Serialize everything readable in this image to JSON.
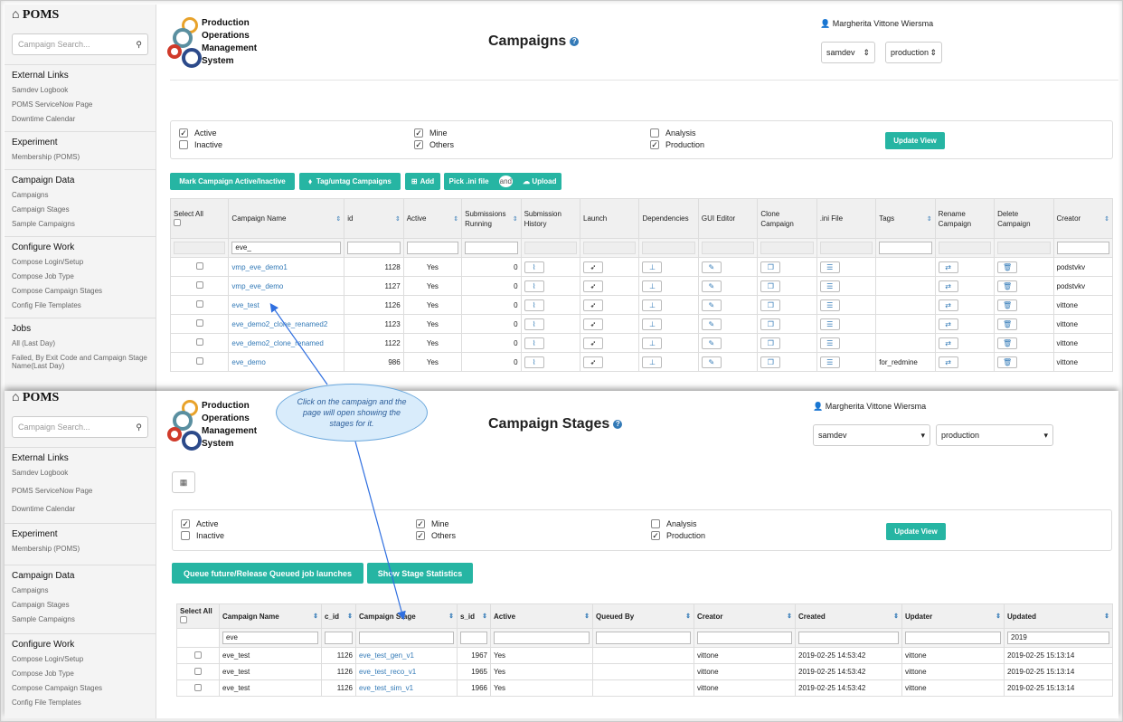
{
  "sidebar": {
    "brand": "POMS",
    "search_placeholder": "Campaign Search...",
    "sections": [
      {
        "title": "External Links",
        "items": [
          "Samdev Logbook",
          "POMS ServiceNow Page",
          "Downtime Calendar"
        ]
      },
      {
        "title": "Experiment",
        "items": [
          "Membership (POMS)"
        ]
      },
      {
        "title": "Campaign Data",
        "items": [
          "Campaigns",
          "Campaign Stages",
          "Sample Campaigns"
        ]
      },
      {
        "title": "Configure Work",
        "items": [
          "Compose Login/Setup",
          "Compose Job Type",
          "Compose Campaign Stages",
          "Config File Templates"
        ]
      },
      {
        "title": "Jobs",
        "items": [
          "All (Last Day)",
          "Failed, By Exit Code and Campaign Stage",
          "Name(Last Day)"
        ]
      }
    ]
  },
  "logo": {
    "lines": [
      "Production",
      "Operations",
      "Management",
      "System"
    ]
  },
  "user_name": "Margherita Vittone Wiersma",
  "experiment_select": "samdev",
  "role_select": "production",
  "filters": {
    "active": "Active",
    "inactive": "Inactive",
    "mine": "Mine",
    "others": "Others",
    "analysis": "Analysis",
    "production": "Production",
    "update": "Update View"
  },
  "campaigns_page": {
    "title": "Campaigns",
    "buttons": {
      "mark": "Mark Campaign Active/Inactive",
      "tag": "Tag/untag Campaigns",
      "add": "Add",
      "pick": "Pick .ini file",
      "and": "and",
      "upload": "Upload"
    },
    "columns": [
      "Select All",
      "Campaign Name",
      "id",
      "Active",
      "Submissions Running",
      "Submission History",
      "Launch",
      "Dependencies",
      "GUI Editor",
      "Clone Campaign",
      ".ini File",
      "Tags",
      "Rename Campaign",
      "Delete Campaign",
      "Creator"
    ],
    "filter_name": "eve_",
    "rows": [
      {
        "name": "vmp_eve_demo1",
        "id": "1128",
        "active": "Yes",
        "running": "0",
        "tags": "",
        "creator": "podstvkv"
      },
      {
        "name": "vmp_eve_demo",
        "id": "1127",
        "active": "Yes",
        "running": "0",
        "tags": "",
        "creator": "podstvkv"
      },
      {
        "name": "eve_test",
        "id": "1126",
        "active": "Yes",
        "running": "0",
        "tags": "",
        "creator": "vittone"
      },
      {
        "name": "eve_demo2_clone_renamed2",
        "id": "1123",
        "active": "Yes",
        "running": "0",
        "tags": "",
        "creator": "vittone"
      },
      {
        "name": "eve_demo2_clone_renamed",
        "id": "1122",
        "active": "Yes",
        "running": "0",
        "tags": "",
        "creator": "vittone"
      },
      {
        "name": "eve_demo",
        "id": "986",
        "active": "Yes",
        "running": "0",
        "tags": "for_redmine",
        "creator": "vittone"
      }
    ]
  },
  "stages_page": {
    "title": "Campaign Stages",
    "buttons": {
      "queue": "Queue future/Release Queued job launches",
      "stats": "Show Stage Statistics"
    },
    "columns": [
      "Select All",
      "Campaign Name",
      "c_id",
      "Campaign Stage",
      "s_id",
      "Active",
      "Queued By",
      "Creator",
      "Created",
      "Updater",
      "Updated"
    ],
    "filter_name": "eve",
    "filter_updated": "2019",
    "rows": [
      {
        "campaign": "eve_test",
        "c_id": "1126",
        "stage": "eve_test_gen_v1",
        "s_id": "1967",
        "active": "Yes",
        "queued": "",
        "creator": "vittone",
        "created": "2019-02-25 14:53:42",
        "updater": "vittone",
        "updated": "2019-02-25 15:13:14"
      },
      {
        "campaign": "eve_test",
        "c_id": "1126",
        "stage": "eve_test_reco_v1",
        "s_id": "1965",
        "active": "Yes",
        "queued": "",
        "creator": "vittone",
        "created": "2019-02-25 14:53:42",
        "updater": "vittone",
        "updated": "2019-02-25 15:13:14"
      },
      {
        "campaign": "eve_test",
        "c_id": "1126",
        "stage": "eve_test_sim_v1",
        "s_id": "1966",
        "active": "Yes",
        "queued": "",
        "creator": "vittone",
        "created": "2019-02-25 14:53:42",
        "updater": "vittone",
        "updated": "2019-02-25 15:13:14"
      }
    ]
  },
  "callout": "Click on the campaign and the page will open showing the stages for it.",
  "colors": {
    "accent": "#26b5a3",
    "link": "#337ab7",
    "callout_fill": "#d9ecfb"
  }
}
